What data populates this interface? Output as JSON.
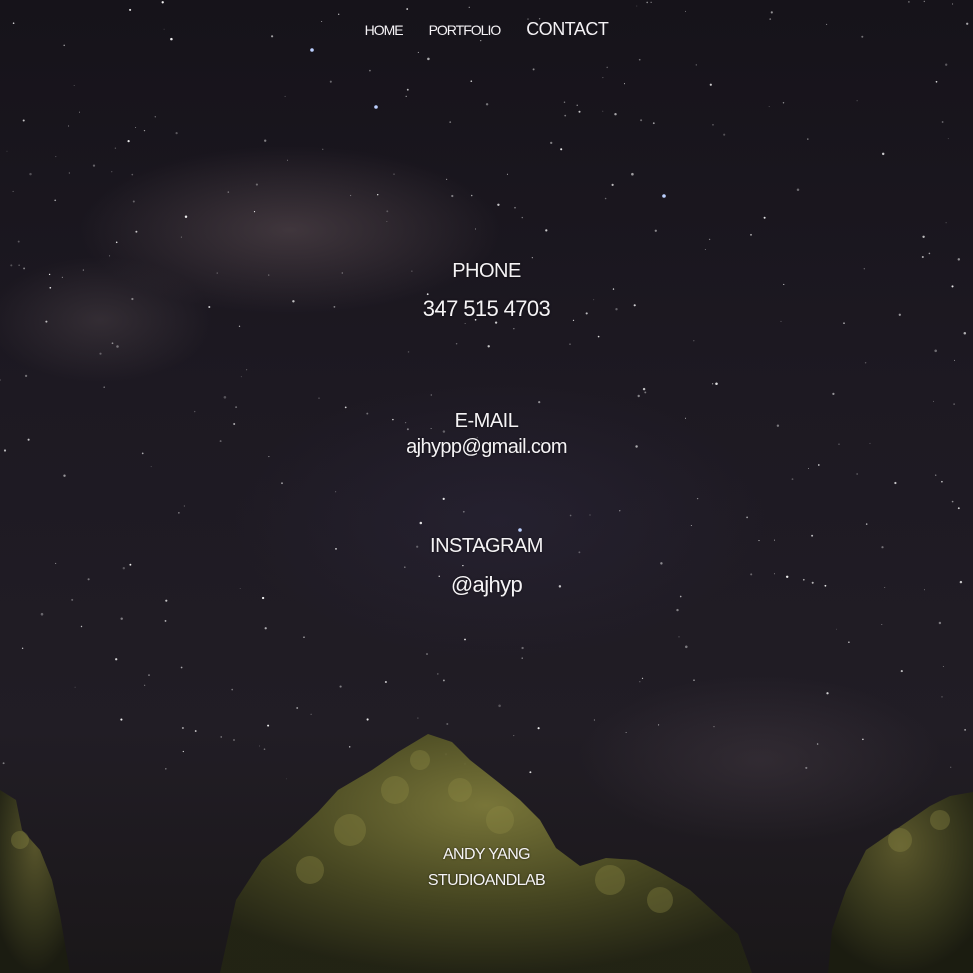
{
  "nav": {
    "items": [
      {
        "label": "HOME"
      },
      {
        "label": "PORTFOLIO"
      },
      {
        "label": "CONTACT"
      }
    ]
  },
  "contact": {
    "phone_heading": "PHONE",
    "phone_value": "347 515 4703",
    "email_heading": "E-MAIL",
    "email_value": "ajhypp@gmail.com",
    "instagram_heading": "INSTAGRAM",
    "instagram_value": "@ajhyp"
  },
  "footer": {
    "name": "ANDY YANG",
    "studio": "STUDIOANDLAB"
  }
}
